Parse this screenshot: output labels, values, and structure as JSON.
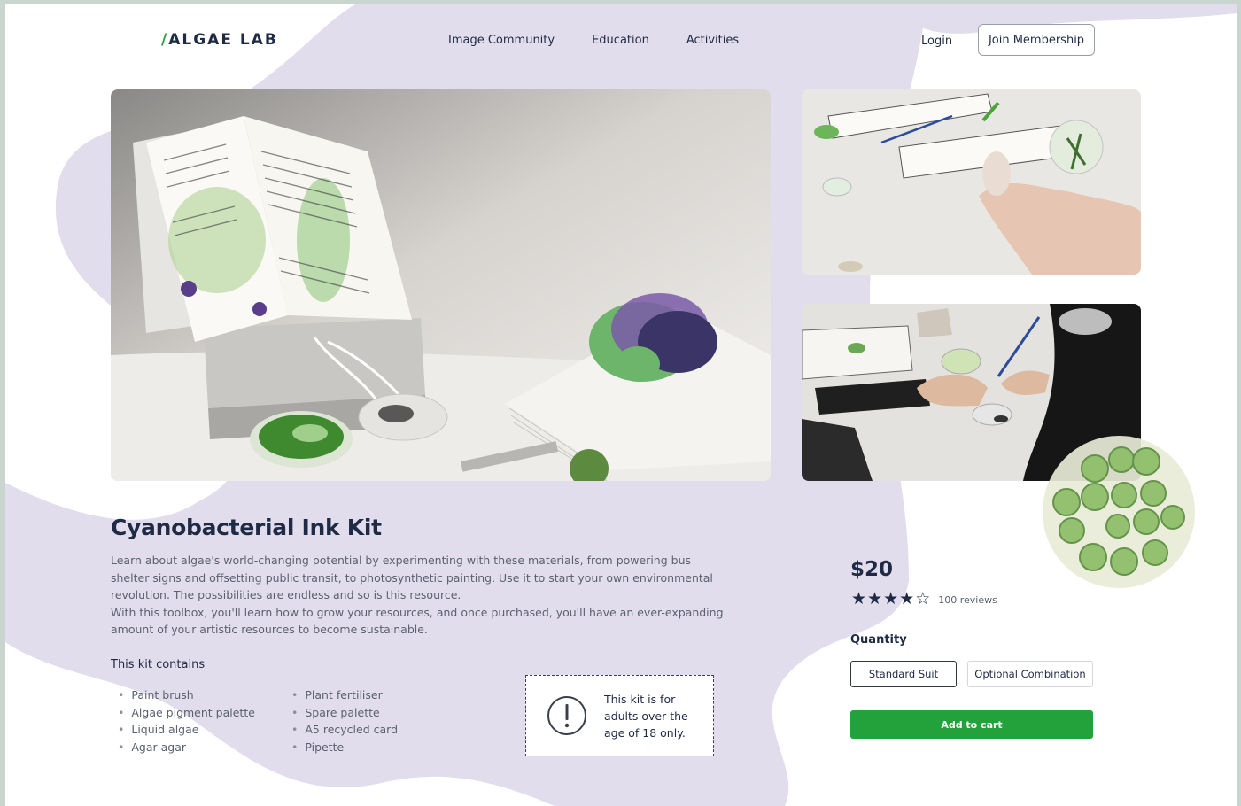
{
  "header": {
    "logo_slash": "/",
    "logo_text": "ALGAE LAB",
    "nav": [
      "Image Community",
      "Education",
      "Activities"
    ],
    "login": "Login",
    "join": "Join Membership"
  },
  "product": {
    "title": "Cyanobacterial Ink Kit",
    "description_1": "Learn about algae's world-changing potential by experimenting with these materials, from powering bus shelter signs and offsetting public transit, to photosynthetic painting. Use it to start your own environmental revolution. The possibilities are endless and so is this resource.",
    "description_2": "With this toolbox, you'll learn how to grow your resources, and once purchased, you'll have an ever-expanding amount of your artistic resources to become sustainable.",
    "contains_title": "This kit contains",
    "contains_col1": [
      "Paint brush",
      "Algae pigment palette",
      "Liquid algae",
      "Agar agar"
    ],
    "contains_col2": [
      "Plant fertiliser",
      "Spare palette",
      "A5 recycled card",
      "Pipette"
    ],
    "notice": "This kit is for adults over the age of 18 only."
  },
  "purchase": {
    "price": "$20",
    "rating": 4,
    "rating_max": 5,
    "reviews": "100 reviews",
    "quantity_label": "Quantity",
    "options": [
      "Standard Suit",
      "Optional Combination"
    ],
    "selected_option": "Standard Suit",
    "add_to_cart": "Add to cart"
  },
  "colors": {
    "accent_green": "#23a13a",
    "blob_lavender": "#e1dcec",
    "text_dark": "#1f2a44"
  }
}
